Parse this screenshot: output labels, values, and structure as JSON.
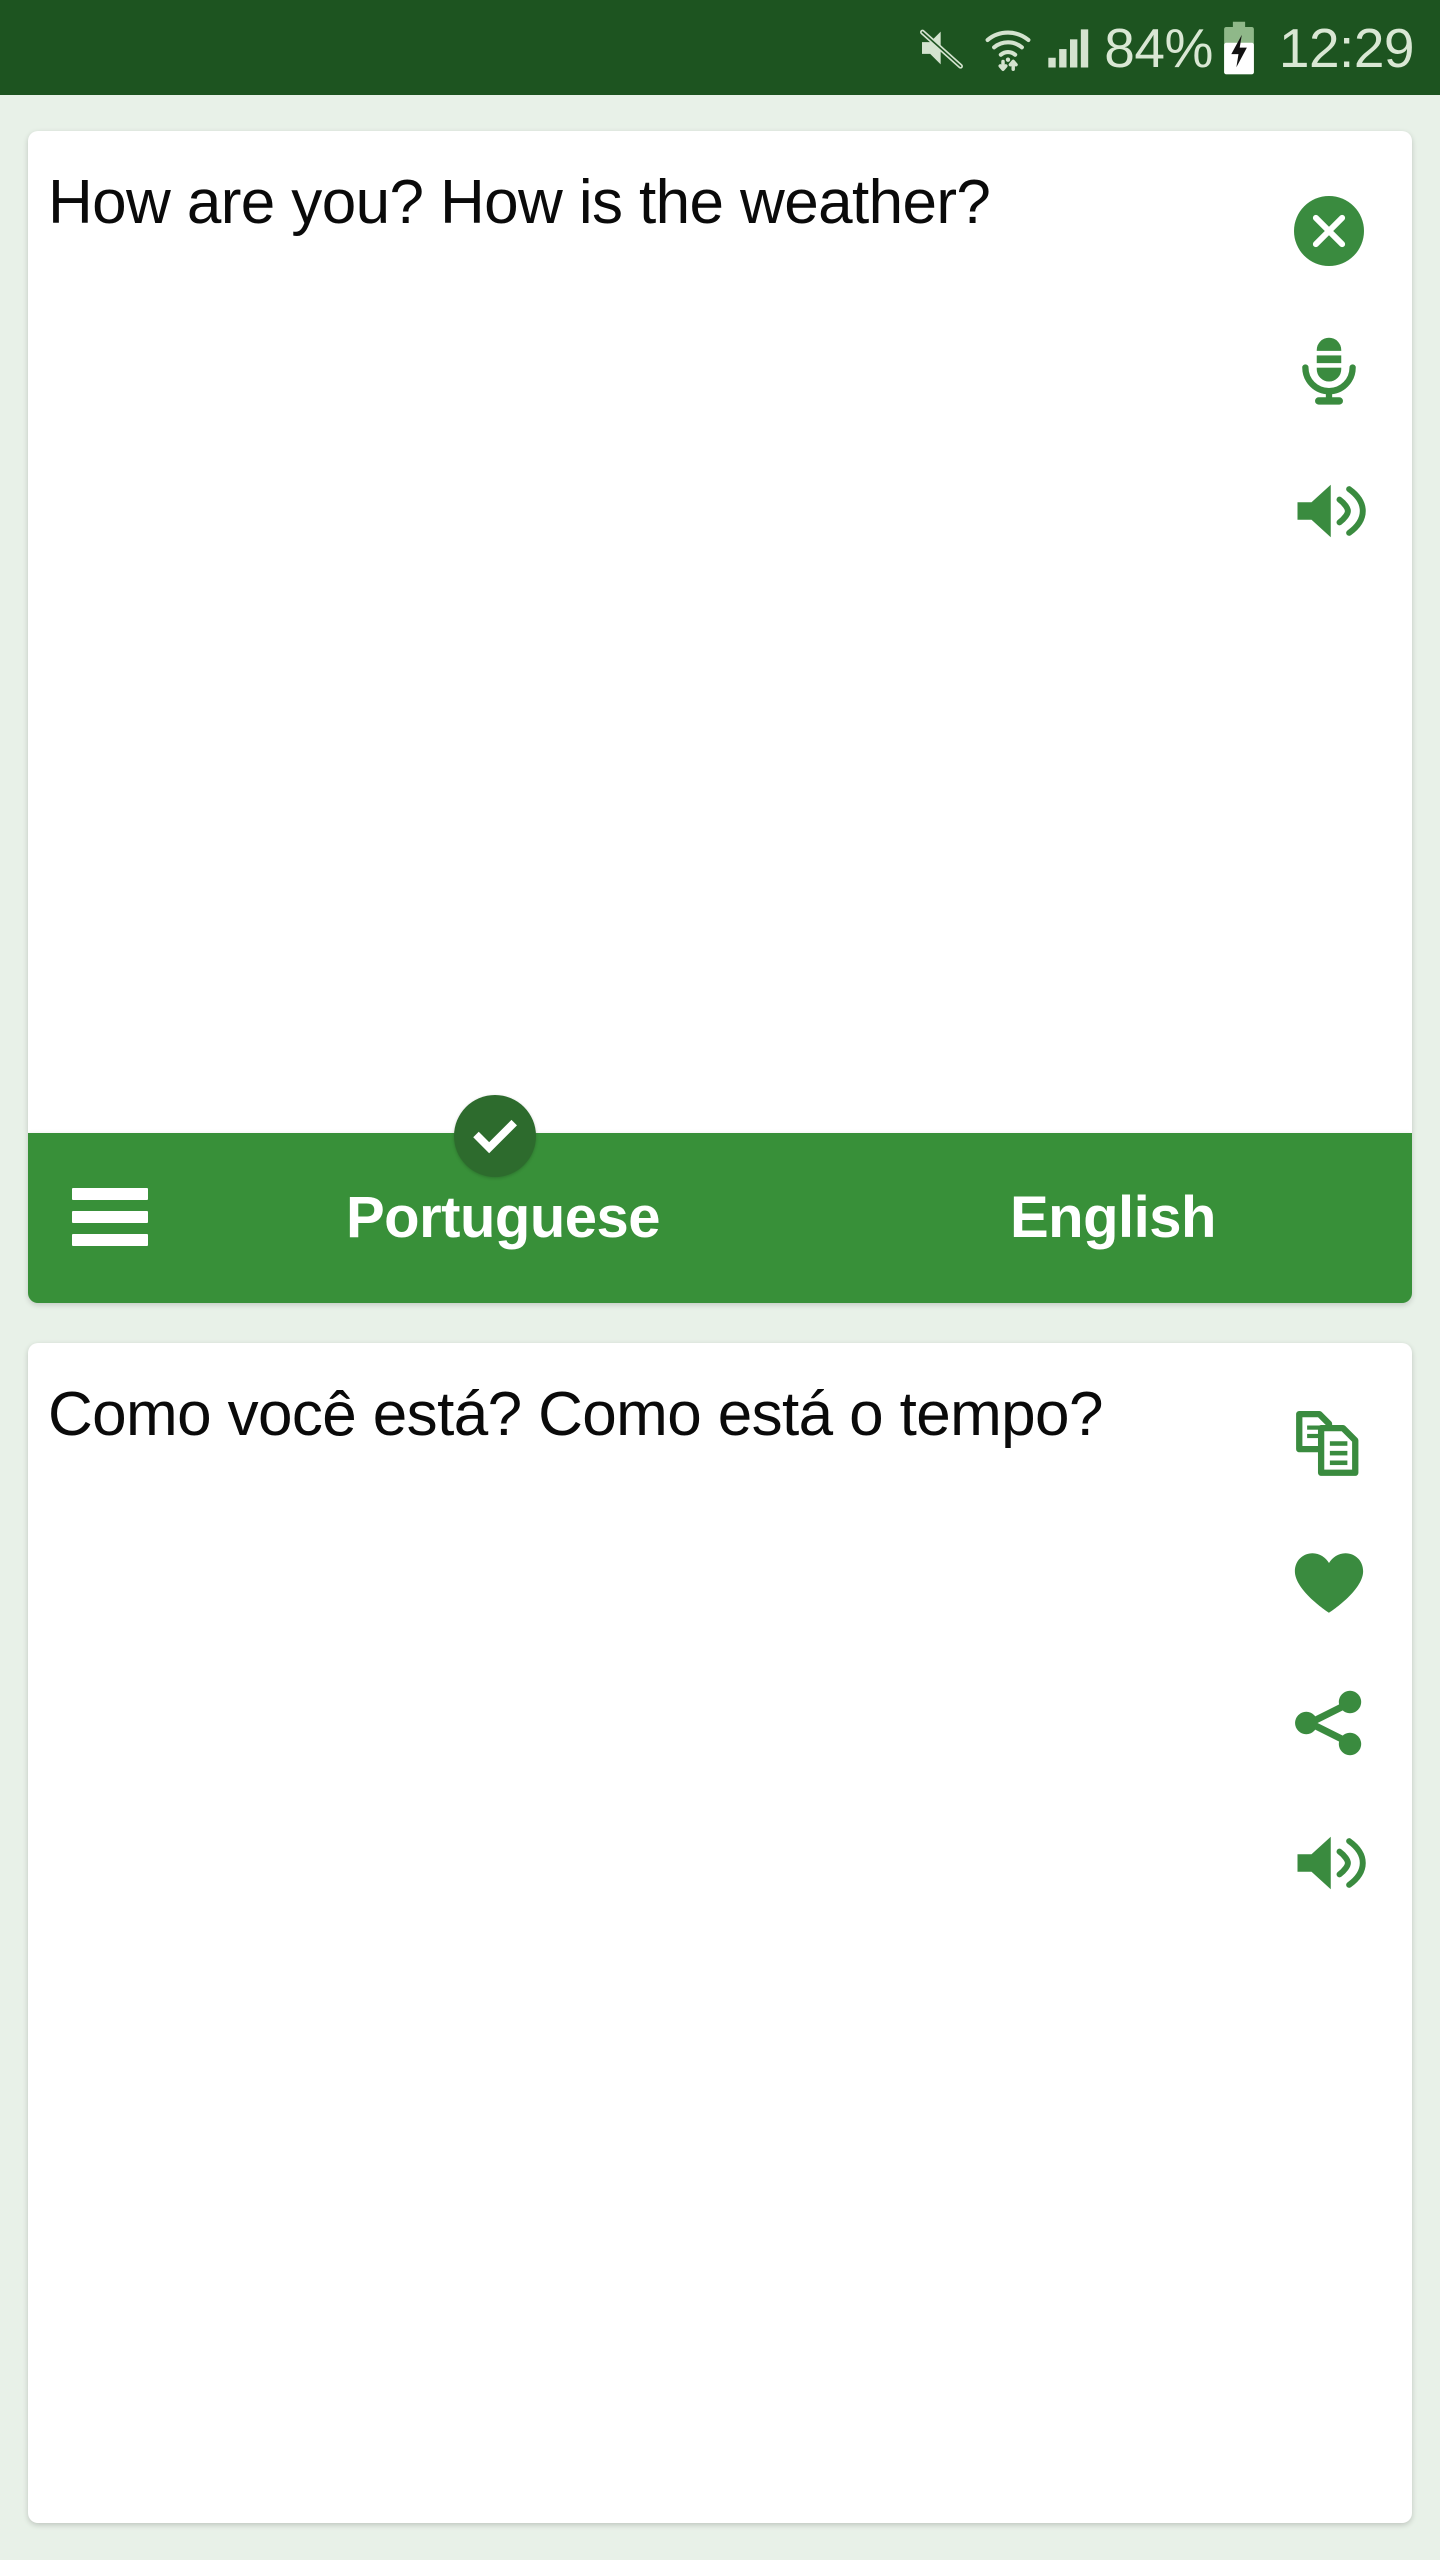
{
  "status_bar": {
    "background_color": "#1d5420",
    "icon_color": "#d4e3cf",
    "mute_icon": "mute-speaker-icon",
    "wifi_icon": "wifi-data-transfer-icon",
    "signal_icon": "cellular-signal-icon",
    "battery_icon": "battery-charging-icon",
    "battery_percent": "84%",
    "clock": "12:29"
  },
  "source_card": {
    "text": "How are you? How is the weather?",
    "actions": [
      {
        "name": "clear-button",
        "icon": "close-circle-icon",
        "label": "Clear"
      },
      {
        "name": "microphone-button",
        "icon": "microphone-icon",
        "label": "Voice input"
      },
      {
        "name": "speak-source-button",
        "icon": "speaker-icon",
        "label": "Listen"
      }
    ]
  },
  "language_bar": {
    "background_color": "#389039",
    "menu_icon": "hamburger-menu-icon",
    "source_language": "Portuguese",
    "target_language": "English",
    "selected_indicator": "check-circle-icon",
    "selected_language": "Portuguese"
  },
  "target_card": {
    "text": "Como você está? Como está o tempo?",
    "actions": [
      {
        "name": "copy-button",
        "icon": "copy-icon",
        "label": "Copy"
      },
      {
        "name": "favorite-button",
        "icon": "heart-icon",
        "label": "Favorite"
      },
      {
        "name": "share-button",
        "icon": "share-icon",
        "label": "Share"
      },
      {
        "name": "speak-target-button",
        "icon": "speaker-icon",
        "label": "Listen"
      }
    ]
  },
  "theme": {
    "page_background": "#e8f1e8",
    "accent_green": "#389039",
    "dark_green": "#1d5420",
    "icon_green": "#3a8b3f",
    "card_background": "#ffffff",
    "text_color": "#0a0a0a"
  }
}
